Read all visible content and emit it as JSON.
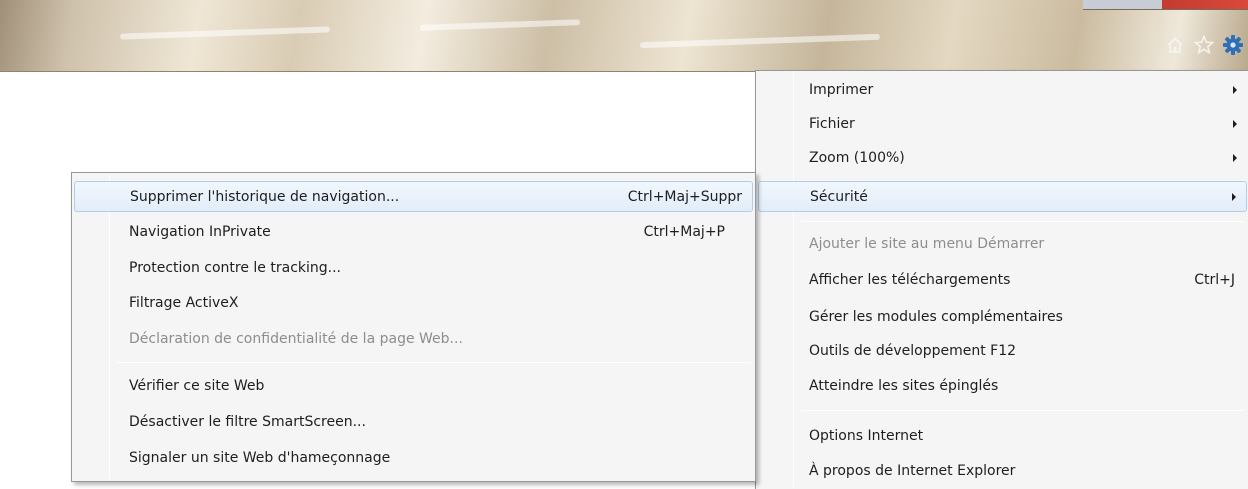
{
  "toolbar": {
    "icons": [
      "home-icon",
      "favorites-star-icon",
      "tools-gear-icon"
    ]
  },
  "colors": {
    "menu_bg": "#f5f5f5",
    "menu_border": "#979797",
    "highlight_bg": "#e2edf9",
    "highlight_border": "#b3cde8",
    "disabled_text": "#8d8d8d",
    "gear_blue": "#2f6fb6"
  },
  "tools_menu": {
    "items": [
      {
        "label": "Imprimer",
        "submenu": true
      },
      {
        "label": "Fichier",
        "submenu": true
      },
      {
        "label": "Zoom (100%)",
        "submenu": true
      },
      {
        "label": "Sécurité",
        "submenu": true,
        "highlighted": true
      },
      {
        "label": "Ajouter le site au menu Démarrer",
        "disabled": true
      },
      {
        "label": "Afficher les téléchargements",
        "shortcut": "Ctrl+J"
      },
      {
        "label": "Gérer les modules complémentaires"
      },
      {
        "label": "Outils de développement F12"
      },
      {
        "label": "Atteindre les sites épinglés"
      },
      {
        "label": "Options Internet"
      },
      {
        "label": "À propos de Internet Explorer"
      }
    ]
  },
  "security_menu": {
    "items": [
      {
        "label": "Supprimer l'historique de navigation...",
        "shortcut": "Ctrl+Maj+Suppr",
        "highlighted": true
      },
      {
        "label": "Navigation InPrivate",
        "shortcut": "Ctrl+Maj+P"
      },
      {
        "label": "Protection contre le tracking..."
      },
      {
        "label": "Filtrage ActiveX"
      },
      {
        "label": "Déclaration de confidentialité de la page Web...",
        "disabled": true
      },
      {
        "label": "Vérifier ce site Web"
      },
      {
        "label": "Désactiver le filtre SmartScreen..."
      },
      {
        "label": "Signaler un site Web d'hameçonnage"
      }
    ]
  }
}
